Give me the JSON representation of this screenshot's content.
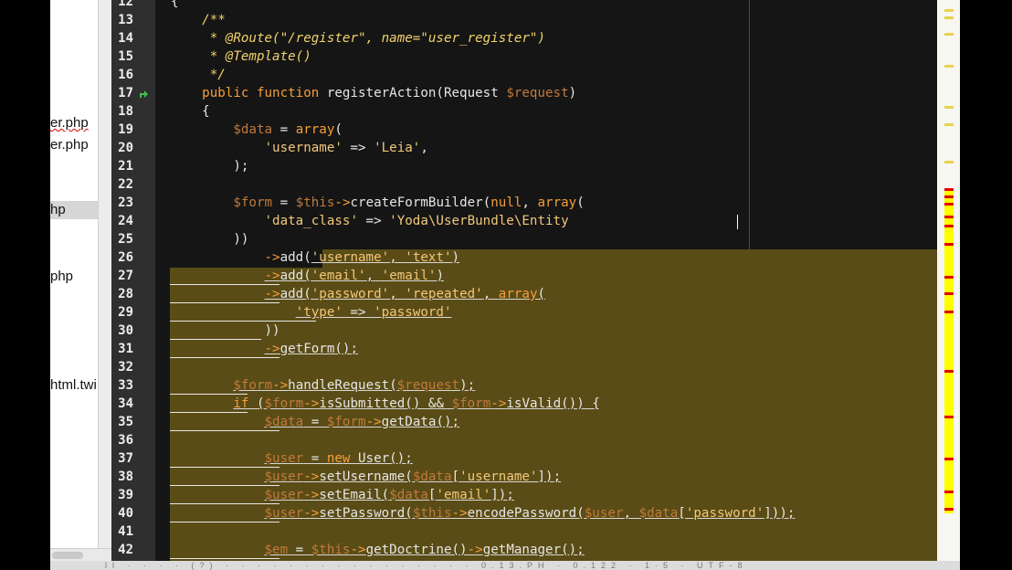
{
  "project_panel": {
    "files": [
      {
        "label": "er.php",
        "has_error": true
      },
      {
        "label": "er.php",
        "has_error": false
      },
      {
        "label": "hp",
        "selected": true
      },
      {
        "label": "php"
      },
      {
        "label": "html.twi"
      }
    ]
  },
  "editor": {
    "line_numbers": [
      "12",
      "13",
      "14",
      "15",
      "16",
      "17",
      "18",
      "19",
      "20",
      "21",
      "22",
      "23",
      "24",
      "25",
      "26",
      "27",
      "28",
      "29",
      "30",
      "31",
      "32",
      "33",
      "34",
      "35",
      "36",
      "37",
      "38",
      "39",
      "40",
      "41",
      "42"
    ],
    "colors": {
      "background": "#151515",
      "highlight": "#5a4c16",
      "keyword": "#f49e3c",
      "variable": "#c07a3c",
      "string": "#f2c77a",
      "comment": "#f1d26b",
      "gutter": "#2f2f2f",
      "error_stripe": "#ffff00"
    },
    "code": {
      "l12": "{",
      "l13": "    /**",
      "l14": "     * @Route(\"/register\", name=\"user_register\")",
      "l15": "     * @Template()",
      "l16": "     */",
      "l17": [
        "    ",
        "public ",
        "function ",
        "registerAction(Request ",
        "$request",
        ")"
      ],
      "l18": "    {",
      "l19": [
        "        ",
        "$data",
        " = ",
        "array",
        "("
      ],
      "l20": [
        "            ",
        "'username'",
        " => ",
        "'Leia'",
        ","
      ],
      "l21": "        );",
      "l22": "",
      "l23": [
        "        ",
        "$form",
        " = ",
        "$this",
        "->",
        "createFormBuilder(",
        "null",
        ", ",
        "array",
        "("
      ],
      "l24": [
        "            ",
        "'data_class'",
        " => ",
        "'Yoda\\UserBundle\\Entity"
      ],
      "l25": "        ))",
      "l26": [
        "            ",
        "->",
        "add(",
        "'username'",
        ", ",
        "'text'",
        ")"
      ],
      "l27": [
        "            ",
        "->",
        "add(",
        "'email'",
        ", ",
        "'email'",
        ")"
      ],
      "l28": [
        "            ",
        "->",
        "add(",
        "'password'",
        ", ",
        "'repeated'",
        ", ",
        "array",
        "("
      ],
      "l29": [
        "                ",
        "'type'",
        " => ",
        "'password'"
      ],
      "l30": "            ))",
      "l31": [
        "            ",
        "->",
        "getForm();"
      ],
      "l32": "",
      "l33": [
        "        ",
        "$form",
        "->",
        "handleRequest(",
        "$request",
        ");"
      ],
      "l34": [
        "        ",
        "if",
        " (",
        "$form",
        "->",
        "isSubmitted() && ",
        "$form",
        "->",
        "isValid()) {"
      ],
      "l35": [
        "            ",
        "$data",
        " = ",
        "$form",
        "->",
        "getData();"
      ],
      "l36": "",
      "l37": [
        "            ",
        "$user",
        " = ",
        "new ",
        "User();"
      ],
      "l38": [
        "            ",
        "$user",
        "->",
        "setUsername(",
        "$data",
        "[",
        "'username'",
        "]);"
      ],
      "l39": [
        "            ",
        "$user",
        "->",
        "setEmail(",
        "$data",
        "[",
        "'email'",
        "]);"
      ],
      "l40": [
        "            ",
        "$user",
        "->",
        "setPassword(",
        "$this",
        "->",
        "encodePassword(",
        "$user",
        ", ",
        "$data",
        "[",
        "'password'",
        "]));"
      ],
      "l41": "",
      "l42": [
        "            ",
        "$em",
        " = ",
        "$this",
        "->",
        "getDoctrine()",
        "->",
        "getManager();"
      ]
    }
  },
  "status_bar": {
    "text": "ll   ·  ·   ·   ·  (?)  ·    ·   ·   ·   ·   ·   ·    ·   ·    ·   ·   ·   ·  ·   ·  ·  0.13.PH  ·  0.122  ·  1·5  ·  UTF-8"
  }
}
